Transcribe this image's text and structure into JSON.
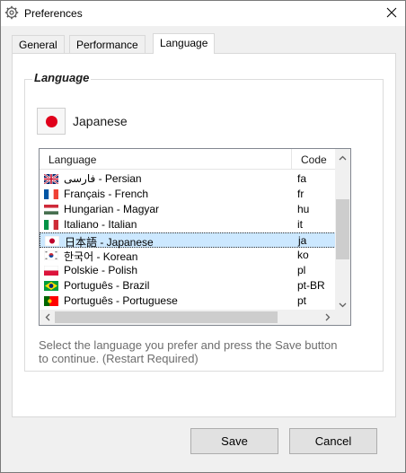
{
  "window": {
    "title": "Preferences"
  },
  "tabs": [
    {
      "label": "General",
      "active": false
    },
    {
      "label": "Performance",
      "active": false
    },
    {
      "label": "Language",
      "active": true
    }
  ],
  "group": {
    "title": "Language"
  },
  "selected_language": {
    "name": "Japanese",
    "flag": "jp-flag-icon"
  },
  "list": {
    "columns": [
      "Language",
      "Code"
    ],
    "rows": [
      {
        "name": "فارسی - Persian",
        "code": "fa",
        "flag": "uk-flag-icon"
      },
      {
        "name": "Français - French",
        "code": "fr",
        "flag": "fr-flag-icon"
      },
      {
        "name": "Hungarian - Magyar",
        "code": "hu",
        "flag": "hu-flag-icon"
      },
      {
        "name": "Italiano - Italian",
        "code": "it",
        "flag": "it-flag-icon"
      },
      {
        "name": "日本語 - Japanese",
        "code": "ja",
        "flag": "jp-flag-icon",
        "selected": true
      },
      {
        "name": "한국어 - Korean",
        "code": "ko",
        "flag": "kr-flag-icon"
      },
      {
        "name": "Polskie - Polish",
        "code": "pl",
        "flag": "pl-flag-icon"
      },
      {
        "name": "Português - Brazil",
        "code": "pt-BR",
        "flag": "br-flag-icon"
      },
      {
        "name": "Português - Portuguese",
        "code": "pt",
        "flag": "pt-flag-icon"
      }
    ]
  },
  "help_text": "Select the language you prefer and press the Save button to continue. (Restart Required)",
  "buttons": {
    "save": "Save",
    "cancel": "Cancel"
  },
  "colors": {
    "selection": "#cce8ff",
    "scroll_thumb": "#cdcdcd",
    "help_text": "#6d6d6d"
  }
}
